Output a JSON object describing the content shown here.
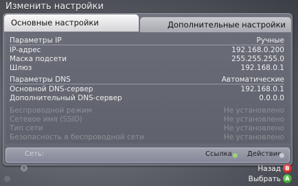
{
  "window": {
    "title": "Изменить настройки"
  },
  "tabs": [
    {
      "label": "Основные настройки"
    },
    {
      "label": "Дополнительные настройки"
    }
  ],
  "groups": {
    "ip": [
      {
        "label": "Параметры IP",
        "value": "Ручные"
      },
      {
        "label": "IP-адрес",
        "value": "192.168.0.200"
      },
      {
        "label": "Маска подсети",
        "value": "255.255.255.0"
      },
      {
        "label": "Шлюз",
        "value": "192.168.0.1"
      }
    ],
    "dns": [
      {
        "label": "Параметры DNS",
        "value": "Автоматические"
      },
      {
        "label": "Основной DNS-сервер",
        "value": "192.168.0.1"
      },
      {
        "label": "Дополнительный DNS-сервер",
        "value": "0.0.0.0"
      }
    ],
    "wireless": [
      {
        "label": "Беспроводной режим",
        "value": "Не установлено"
      },
      {
        "label": "Сетевое имя (SSID)",
        "value": "Не установлено"
      },
      {
        "label": "Тип сети",
        "value": "Не установлено"
      },
      {
        "label": "Безопасность в беспроводной сети",
        "value": "Не установлено"
      }
    ]
  },
  "status": {
    "network_label": "Сеть:",
    "link_label": "Ссылка",
    "action_label": "Действие"
  },
  "footer": {
    "back_label": "Назад",
    "select_label": "Выбрать",
    "b_glyph": "B",
    "a_glyph": "A"
  },
  "colors": {
    "link_indicator": "#9ed17b",
    "back_button": "#d81b1b",
    "select_button": "#2fa81f"
  }
}
